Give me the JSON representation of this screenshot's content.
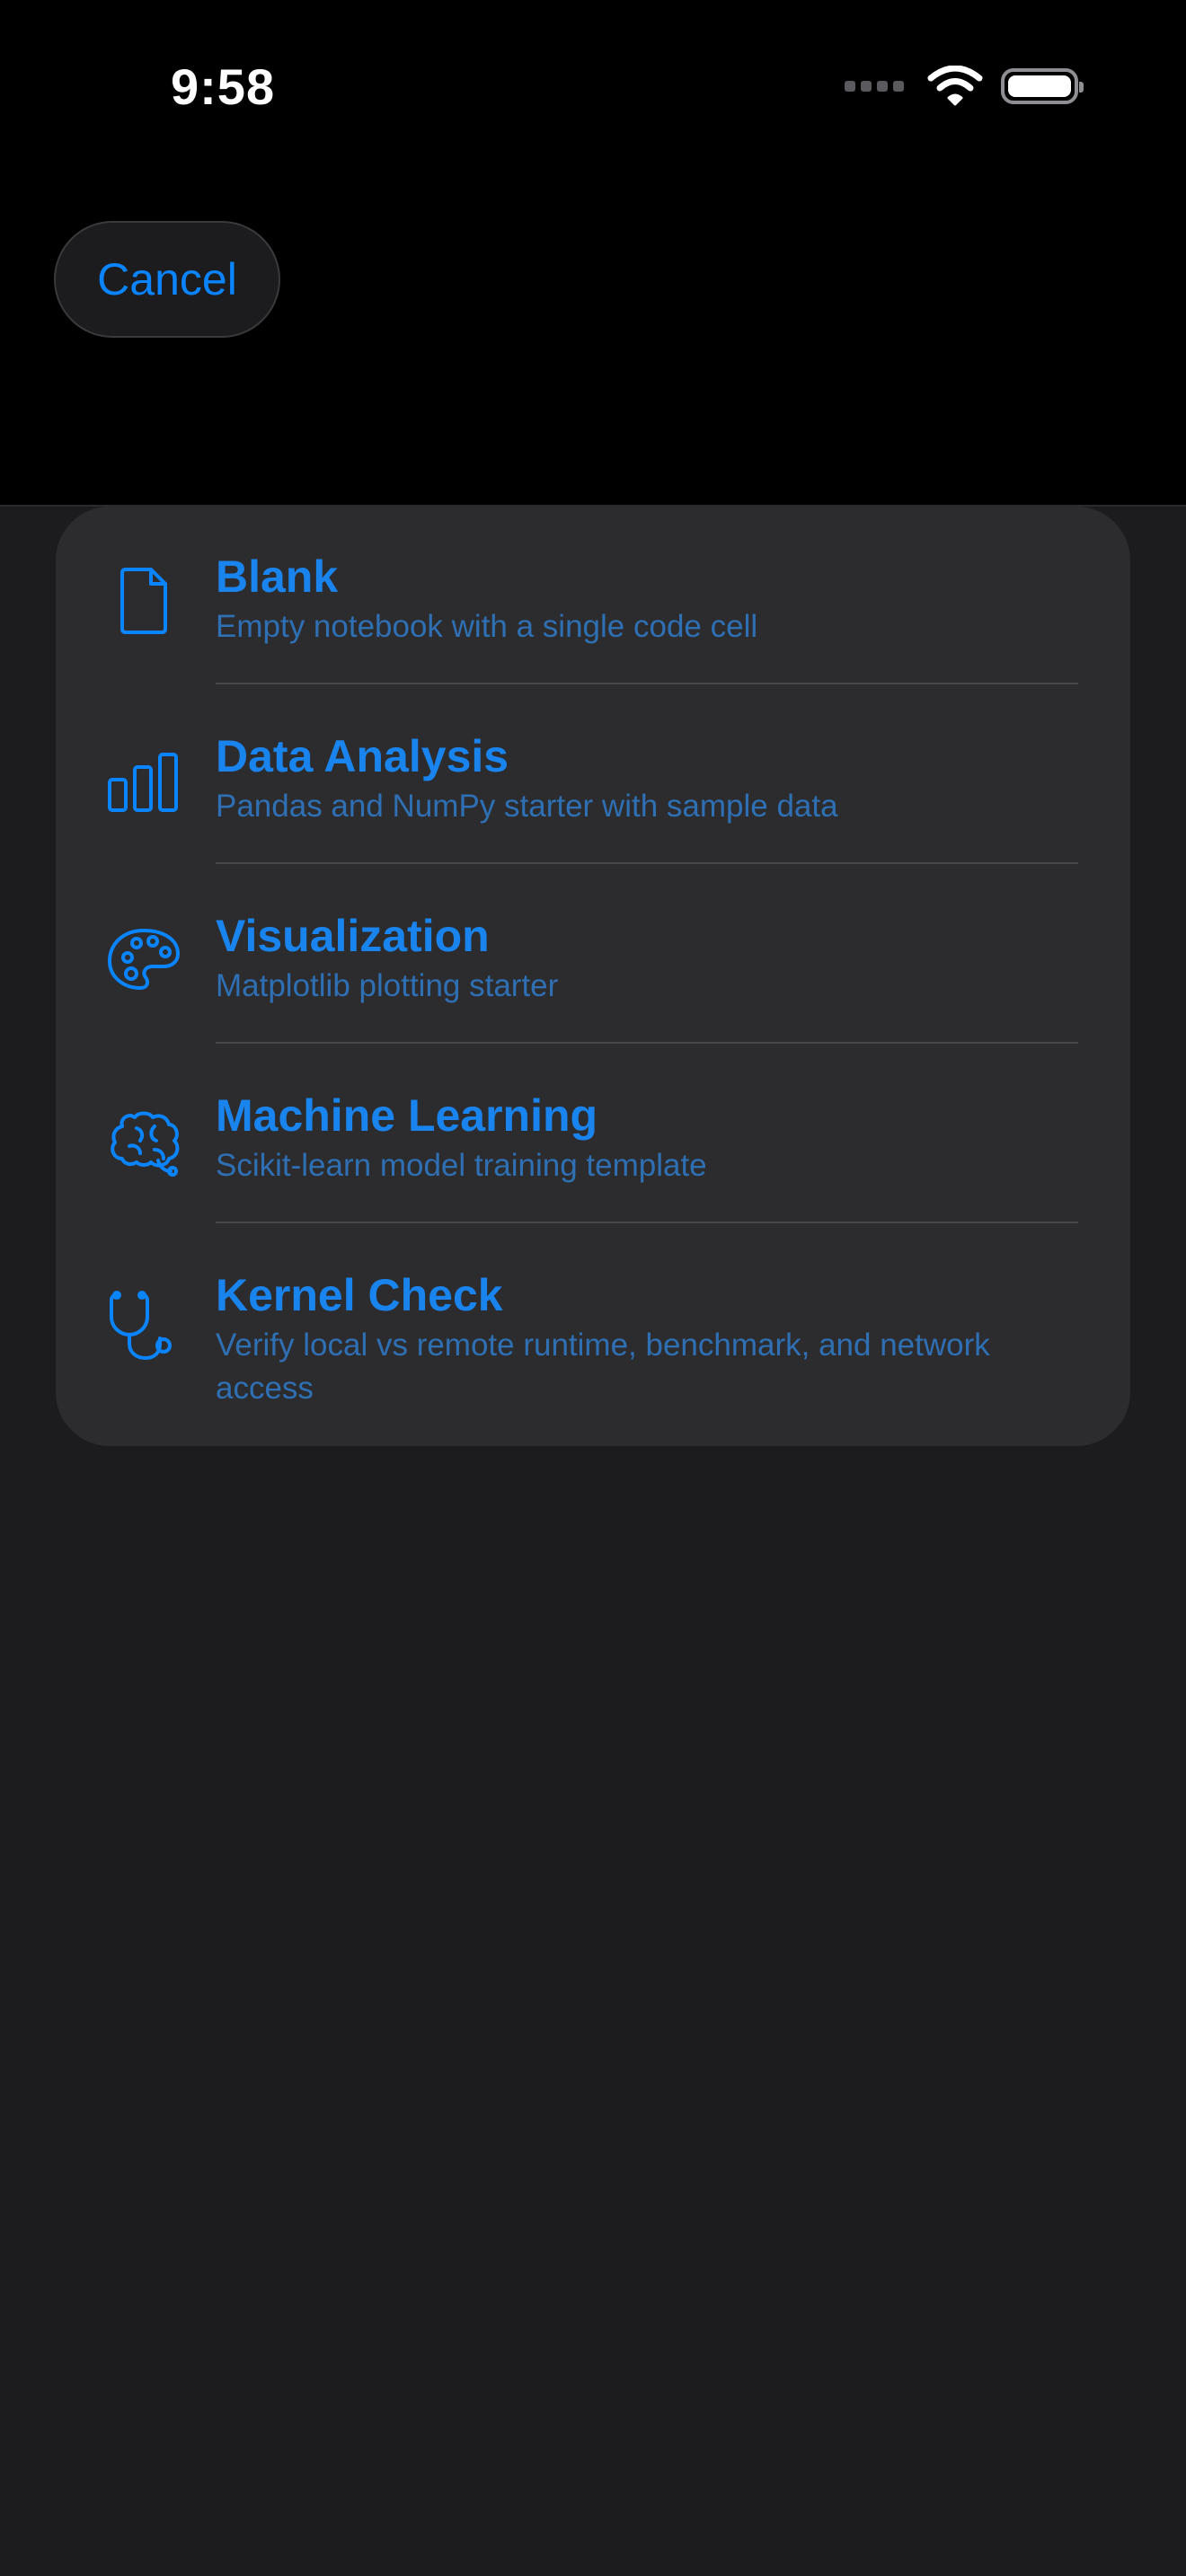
{
  "status_bar": {
    "time": "9:58"
  },
  "toolbar": {
    "cancel_label": "Cancel"
  },
  "colors": {
    "accent": "#0a84ff",
    "background": "#1c1c1e",
    "card": "#2c2c2e"
  },
  "templates": [
    {
      "icon": "document-icon",
      "title": "Blank",
      "subtitle": "Empty notebook with a single code cell"
    },
    {
      "icon": "bar-chart-icon",
      "title": "Data Analysis",
      "subtitle": "Pandas and NumPy starter with sample data"
    },
    {
      "icon": "palette-icon",
      "title": "Visualization",
      "subtitle": "Matplotlib plotting starter"
    },
    {
      "icon": "brain-icon",
      "title": "Machine Learning",
      "subtitle": "Scikit-learn model training template"
    },
    {
      "icon": "stethoscope-icon",
      "title": "Kernel Check",
      "subtitle": "Verify local vs remote runtime, benchmark, and network access"
    }
  ]
}
